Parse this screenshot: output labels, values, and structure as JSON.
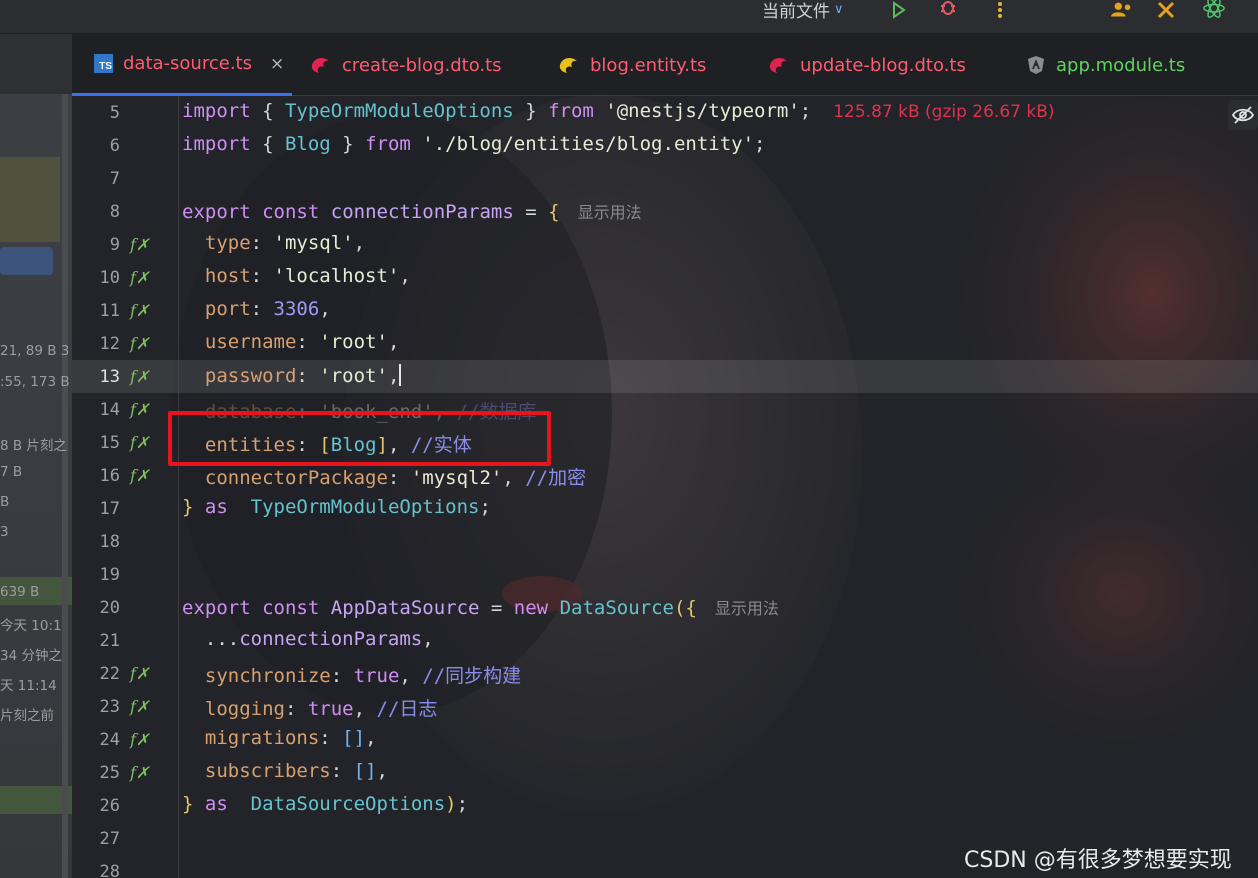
{
  "toolbar": {
    "run_config_label": "当前文件",
    "icons": [
      "run-icon",
      "debug-icon",
      "more-icon",
      "code-with-me-icon",
      "build-icon",
      "react-icon"
    ]
  },
  "side_panel": {
    "meta_lines": [
      {
        "text": "21, 89 B 3"
      },
      {
        "text": ":55, 173 B"
      },
      {
        "text": "8 B 片刻之"
      },
      {
        "text": "7 B"
      },
      {
        "text": "B"
      },
      {
        "text": "3"
      },
      {
        "text": "639 B"
      },
      {
        "text": "今天 10:1"
      },
      {
        "text": "34 分钟之"
      },
      {
        "text": "天 11:14"
      },
      {
        "text": "片刻之前"
      }
    ]
  },
  "tabs": [
    {
      "label": "data-source.ts",
      "color": "#ff5c6f",
      "icon": "typescript-icon",
      "active": true,
      "close": "×"
    },
    {
      "label": "create-blog.dto.ts",
      "color": "#ff5c6f",
      "icon": "nestjs-icon"
    },
    {
      "label": "blog.entity.ts",
      "color": "#ff5c6f",
      "icon": "entity-icon"
    },
    {
      "label": "update-blog.dto.ts",
      "color": "#ff5c6f",
      "icon": "nestjs-icon"
    },
    {
      "label": "app.module.ts",
      "color": "#5fd35f",
      "icon": "angular-icon"
    }
  ],
  "editor": {
    "size_hint": "125.87 kB (gzip 26.67 kB)",
    "usage_hint": "显示用法",
    "current_line": 13,
    "line_numbers": [
      "5",
      "6",
      "7",
      "8",
      "9",
      "10",
      "11",
      "12",
      "13",
      "14",
      "15",
      "16",
      "17",
      "18",
      "19",
      "20",
      "21",
      "22",
      "23",
      "24",
      "25",
      "26",
      "27",
      "28"
    ],
    "lines": {
      "l5": {
        "kw1": "import",
        "p1": " { ",
        "cls": "TypeOrmModuleOptions",
        "p2": " } ",
        "kw2": "from",
        "sp": " ",
        "str": "'@nestjs/typeorm'",
        "end": ";"
      },
      "l6": {
        "kw1": "import",
        "p1": " { ",
        "cls": "Blog",
        "p2": " } ",
        "kw2": "from",
        "sp": " ",
        "str": "'./blog/entities/blog.entity'",
        "end": ";"
      },
      "l8": {
        "kw1": "export",
        "kw2": "const",
        "id": "connectionParams",
        "p": " = ",
        "brk": "{"
      },
      "l9": {
        "prop": "type",
        "p": ": ",
        "str": "'mysql'",
        "end": ","
      },
      "l10": {
        "prop": "host",
        "p": ": ",
        "str": "'localhost'",
        "end": ","
      },
      "l11": {
        "prop": "port",
        "p": ": ",
        "num": "3306",
        "end": ","
      },
      "l12": {
        "prop": "username",
        "p": ": ",
        "str": "'root'",
        "end": ","
      },
      "l13": {
        "prop": "password",
        "p": ": ",
        "str": "'root'",
        "end": ","
      },
      "l14": {
        "prop": "database",
        "p": ": ",
        "str": "'book_end'",
        "end": ", ",
        "cmt": "//数据库"
      },
      "l15": {
        "prop": "entities",
        "p": ": ",
        "b1": "[",
        "cls": "Blog",
        "b2": "]",
        "end": ", ",
        "cmt": "//实体"
      },
      "l16": {
        "prop": "connectorPackage",
        "p": ": ",
        "str": "'mysql2'",
        "end": ", ",
        "cmt": "//加密"
      },
      "l17": {
        "brk": "}",
        "kw": " as ",
        "cls": "TypeOrmModuleOptions",
        "end": ";"
      },
      "l20": {
        "kw1": "export",
        "kw2": "const",
        "id": "AppDataSource",
        "p": " = ",
        "kw3": "new",
        "cls": "DataSource",
        "b1": "(",
        "b2": "{"
      },
      "l21": {
        "p": "...",
        "id": "connectionParams",
        "end": ","
      },
      "l22": {
        "prop": "synchronize",
        "p": ": ",
        "kw": "true",
        "end": ", ",
        "cmt": "//同步构建"
      },
      "l23": {
        "prop": "logging",
        "p": ": ",
        "kw": "true",
        "end": ", ",
        "cmt": "//日志"
      },
      "l24": {
        "prop": "migrations",
        "p": ": ",
        "arr": "[]",
        "end": ","
      },
      "l25": {
        "prop": "subscribers",
        "p": ": ",
        "arr": "[]",
        "end": ","
      },
      "l26": {
        "brk": "}",
        "kw": " as ",
        "cls": "DataSourceOptions",
        "b": ")",
        "end": ";"
      }
    }
  },
  "watermark": "CSDN @有很多梦想要实现"
}
